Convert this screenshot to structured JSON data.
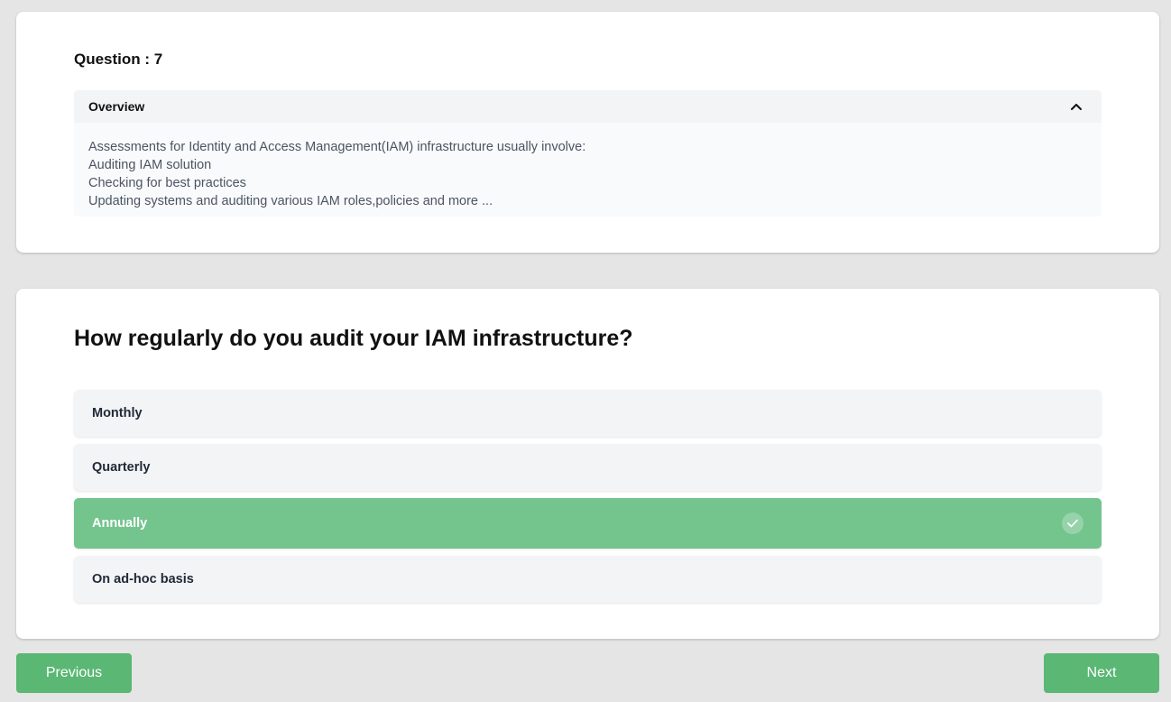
{
  "overview_card": {
    "question_label": "Question : 7",
    "accordion": {
      "title": "Overview",
      "toggle_icon": "chevron-up-icon",
      "lines": [
        "Assessments for Identity and Access Management(IAM) infrastructure usually involve:",
        "Auditing IAM solution",
        "Checking for best practices",
        "Updating systems and auditing various IAM roles,policies and more ..."
      ]
    }
  },
  "question_card": {
    "title": "How regularly do you audit your IAM infrastructure?",
    "options": [
      {
        "label": "Monthly",
        "selected": false
      },
      {
        "label": "Quarterly",
        "selected": false
      },
      {
        "label": "Annually",
        "selected": true,
        "icon": "check-icon"
      },
      {
        "label": "On ad-hoc basis",
        "selected": false
      }
    ]
  },
  "navigation": {
    "previous_label": "Previous",
    "next_label": "Next"
  },
  "colors": {
    "background": "#e5e5e5",
    "selected_option": "#74c48e",
    "button_green": "#5bb774"
  }
}
